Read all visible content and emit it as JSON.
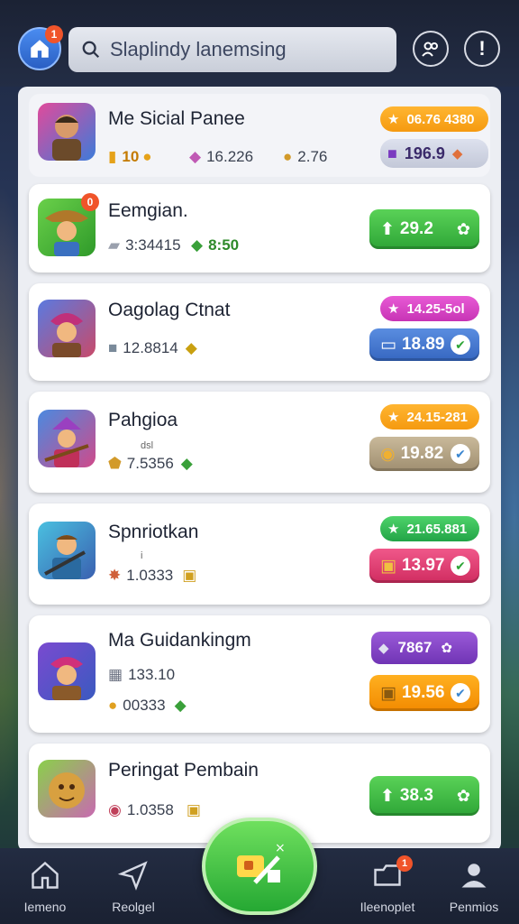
{
  "header": {
    "home_badge": "1",
    "search_text": "Slaplindy lanemsing"
  },
  "cards": [
    {
      "title": "Me Sicial Panee",
      "stats": [
        "10",
        "16.226",
        "2.76"
      ],
      "pill": "06.76 4380",
      "button": "196.9"
    },
    {
      "title": "Eemgian.",
      "stats": [
        "3:34415",
        "8:50"
      ],
      "button": "29.2"
    },
    {
      "title": "Oagolag Ctnat",
      "stats": [
        "12.8814"
      ],
      "pill": "14.25-5ol",
      "button": "18.89"
    },
    {
      "title": "Pahgioa",
      "mini": "dsl",
      "stats": [
        "7.5356"
      ],
      "pill": "24.15-281",
      "button": "19.82"
    },
    {
      "title": "Spnriotkan",
      "mini": "i",
      "stats": [
        "1.0333"
      ],
      "pill": "21.65.881",
      "button": "13.97"
    },
    {
      "title": "Ma Guidankingm",
      "stats": [
        "133.10",
        "00333"
      ],
      "pill": "7867",
      "button": "19.56"
    },
    {
      "title": "Peringat Pembain",
      "stats": [
        "1.0358"
      ],
      "button": "38.3"
    }
  ],
  "nav": {
    "home": "Iemeno",
    "second": "Reolgel",
    "fourth": "Ileenoplet",
    "fourth_badge": "1",
    "fifth": "Penmios"
  },
  "colors": {
    "accent_green": "#2ea537",
    "accent_blue": "#3566c0",
    "pill_orange": "#f59a10"
  }
}
